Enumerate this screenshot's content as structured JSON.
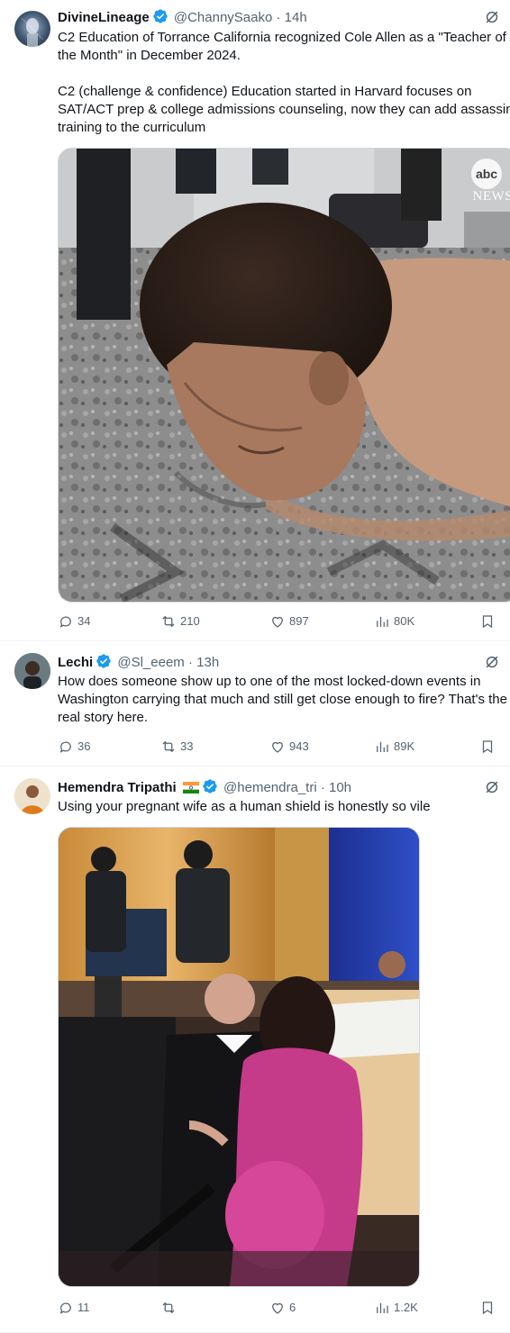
{
  "tweets": [
    {
      "name": "DivineLineage",
      "handle": "@ChannySaako",
      "time": "· 14h",
      "text": "C2 Education of Torrance California recognized Cole Allen as a \"Teacher of the Month\" in December 2024.\n\nC2 (challenge & confidence) Education started in Harvard focuses on SAT/ACT prep & college admissions counseling, now they can add assassin training to the curriculum",
      "media": {
        "watermark_line1": "abc",
        "watermark_line2": "NEWS"
      },
      "replies": "34",
      "reposts": "210",
      "likes": "897",
      "views": "80K"
    },
    {
      "name": "Lechi",
      "handle": "@Sl_eeem",
      "time": "· 13h",
      "text": "How does someone show up to one of the most locked-down events in Washington carrying that much and still get close enough to fire? That's the real story here.",
      "replies": "36",
      "reposts": "33",
      "likes": "943",
      "views": "89K"
    },
    {
      "name": "Hemendra Tripathi",
      "handle": "@hemendra_tri",
      "time": "· 10h",
      "text": "Using your pregnant wife as a human shield is honestly so vile",
      "replies": "11",
      "reposts": "",
      "likes": "6",
      "views": "1.2K"
    }
  ],
  "colors": {
    "verified": "#1d9bf0",
    "text": "#0f1419",
    "muted": "#536471",
    "border": "#cfd9de"
  },
  "icons": [
    "grok-icon",
    "more-icon",
    "reply-icon",
    "repost-icon",
    "like-icon",
    "views-icon",
    "bookmark-icon",
    "verified-badge-icon",
    "india-flag-icon"
  ]
}
